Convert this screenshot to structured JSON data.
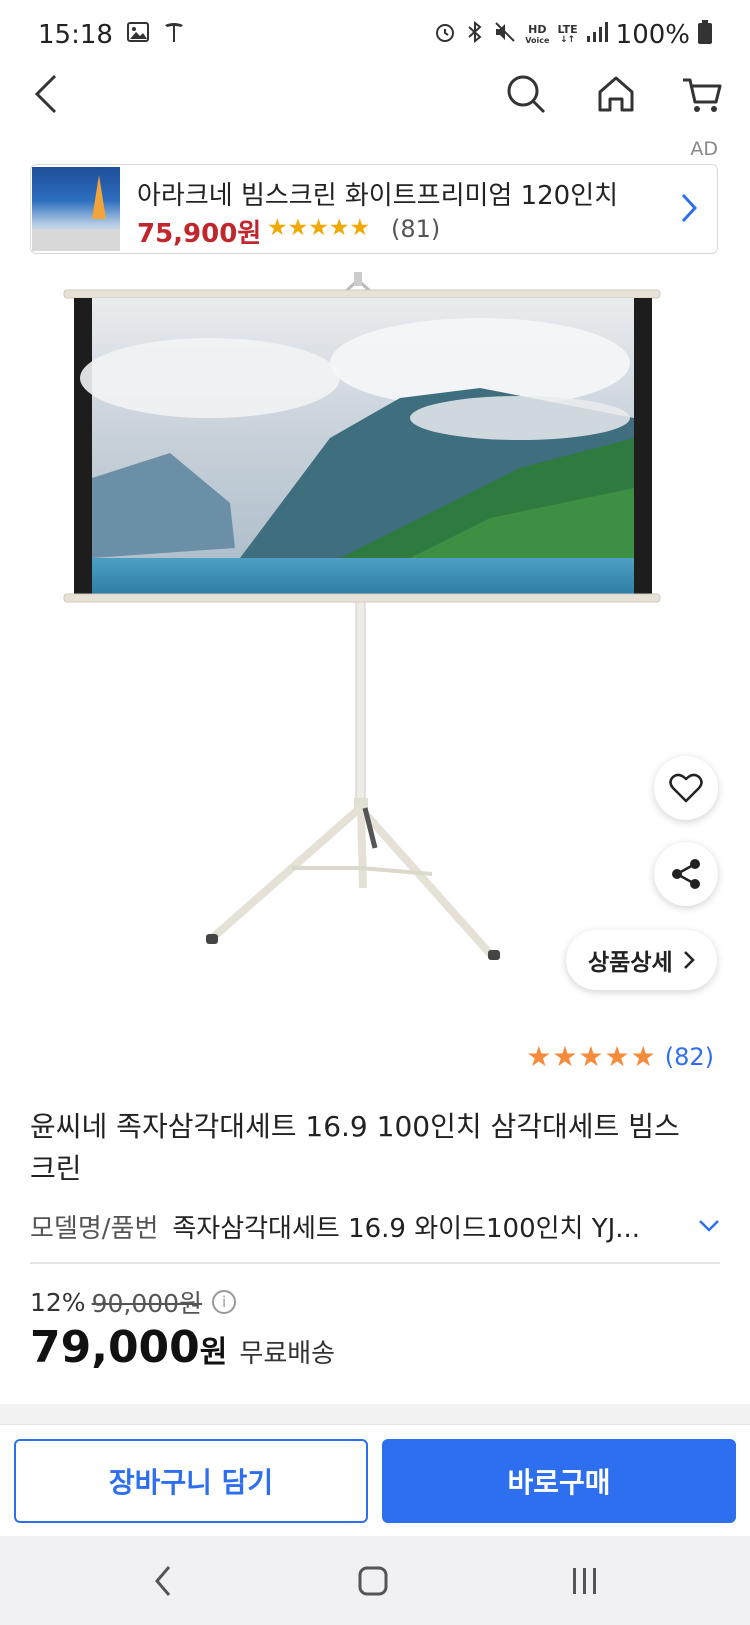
{
  "status": {
    "time": "15:18",
    "battery": "100%",
    "net_hd": "HD",
    "net_voice": "Voice",
    "net_lte": "LTE"
  },
  "nav": {
    "back_icon": "chevron-left-icon",
    "search_icon": "search-icon",
    "home_icon": "home-icon",
    "cart_icon": "cart-icon"
  },
  "ad": {
    "label": "AD",
    "title": "아라크네 빔스크린 화이트프리미엄 120인치",
    "price": "75,900원",
    "stars": "★★★★★",
    "review_count": "(81)"
  },
  "product": {
    "rating_stars": "★★★★★",
    "rating_count": "(82)",
    "title": "윤씨네 족자삼각대세트 16.9 100인치 삼각대세트 빔스크린",
    "model_label": "모델명/품번",
    "model_value": "족자삼각대세트 16.9 와이드100인치 YJ...",
    "discount": "12%",
    "original_price": "90,000원",
    "price": "79,000",
    "price_unit": "원",
    "shipping": "무료배송",
    "detail_button": "상품상세"
  },
  "actions": {
    "cart_label": "장바구니 담기",
    "buy_label": "바로구매"
  },
  "colors": {
    "accent": "#2d6fef",
    "ad_price": "#c0272d",
    "star_ad": "#f0a900",
    "star_product": "#f58b3c"
  }
}
